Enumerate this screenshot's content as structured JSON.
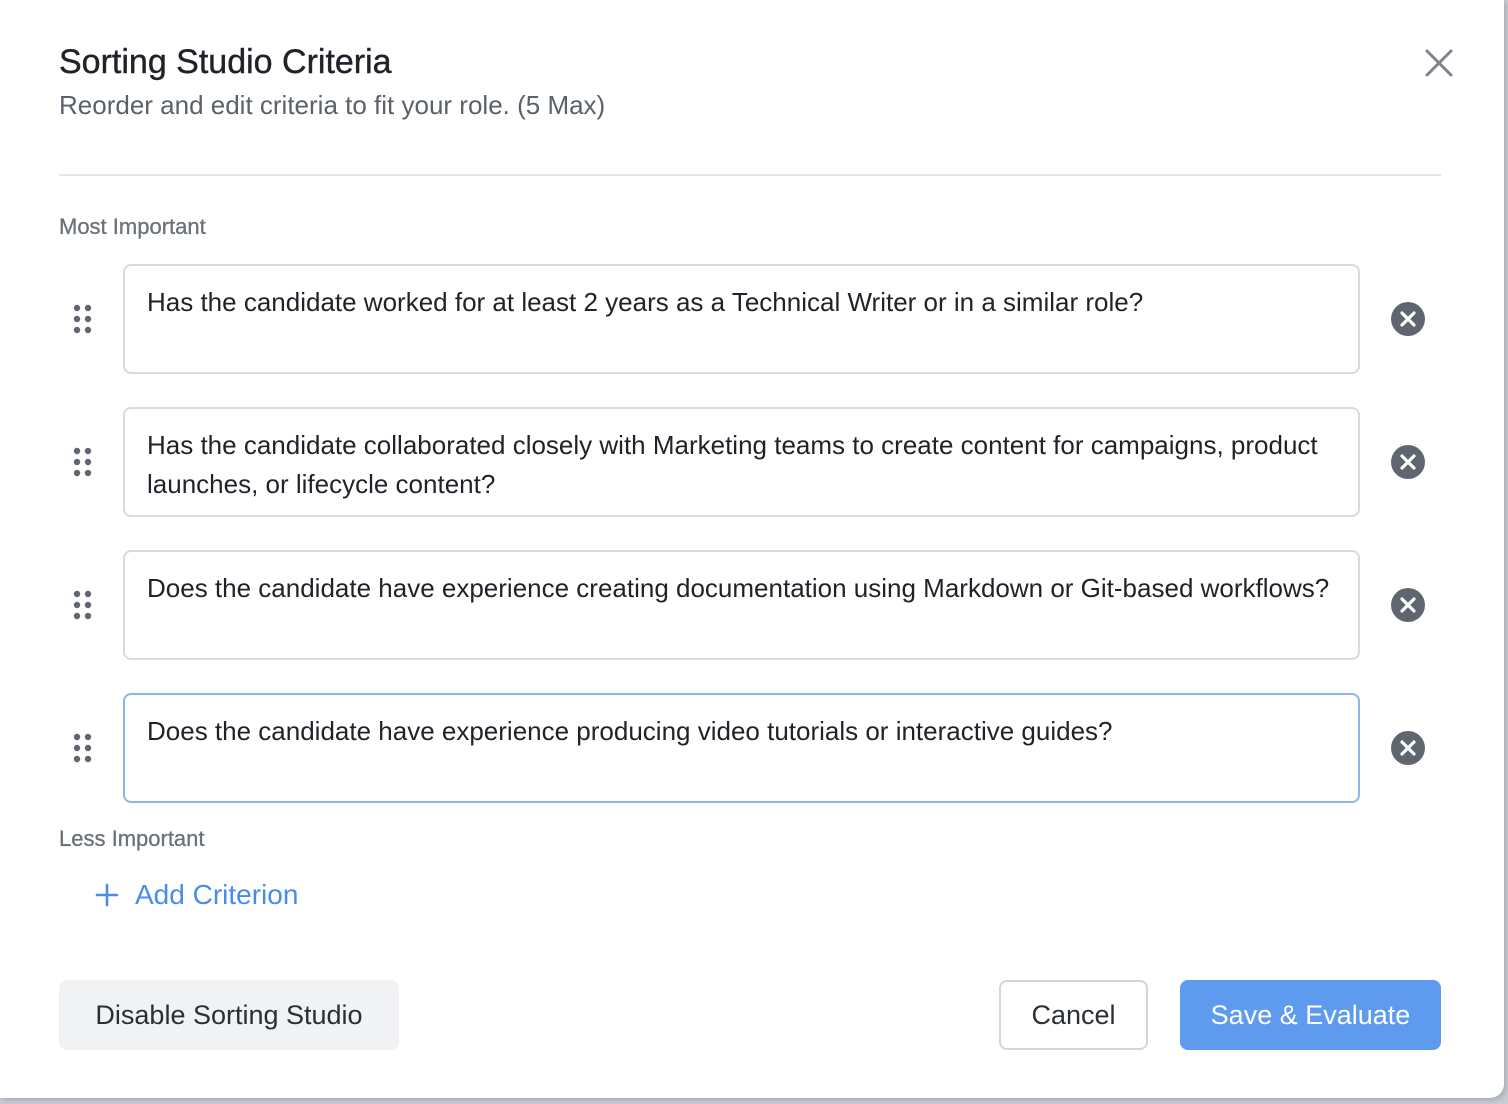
{
  "dialog": {
    "title": "Sorting Studio Criteria",
    "subtitle": "Reorder and edit criteria to fit your role. (5 Max)"
  },
  "sections": {
    "most_important": "Most Important",
    "less_important": "Less Important"
  },
  "criteria": [
    {
      "text": "Has the candidate worked for at least 2 years as a Technical Writer or in a similar role?",
      "focused": false
    },
    {
      "text": "Has the candidate collaborated closely with Marketing teams to create content for campaigns, product launches, or lifecycle content?",
      "focused": false
    },
    {
      "text": "Does the candidate have experience creating documentation using Markdown or Git-based workflows?",
      "focused": false
    },
    {
      "text": "Does the candidate have experience producing video tutorials or interactive guides?",
      "focused": true
    }
  ],
  "actions": {
    "add_criterion": "Add Criterion",
    "disable": "Disable Sorting Studio",
    "cancel": "Cancel",
    "save": "Save & Evaluate"
  },
  "icons": {
    "close": "close-icon",
    "drag": "drag-handle-icon",
    "remove": "remove-circle-icon",
    "add": "plus-icon"
  },
  "colors": {
    "accent": "#4a8de8",
    "primary_button": "#5e9bef",
    "focus_border": "#8bb6ee",
    "remove_icon": "#5f6670"
  }
}
